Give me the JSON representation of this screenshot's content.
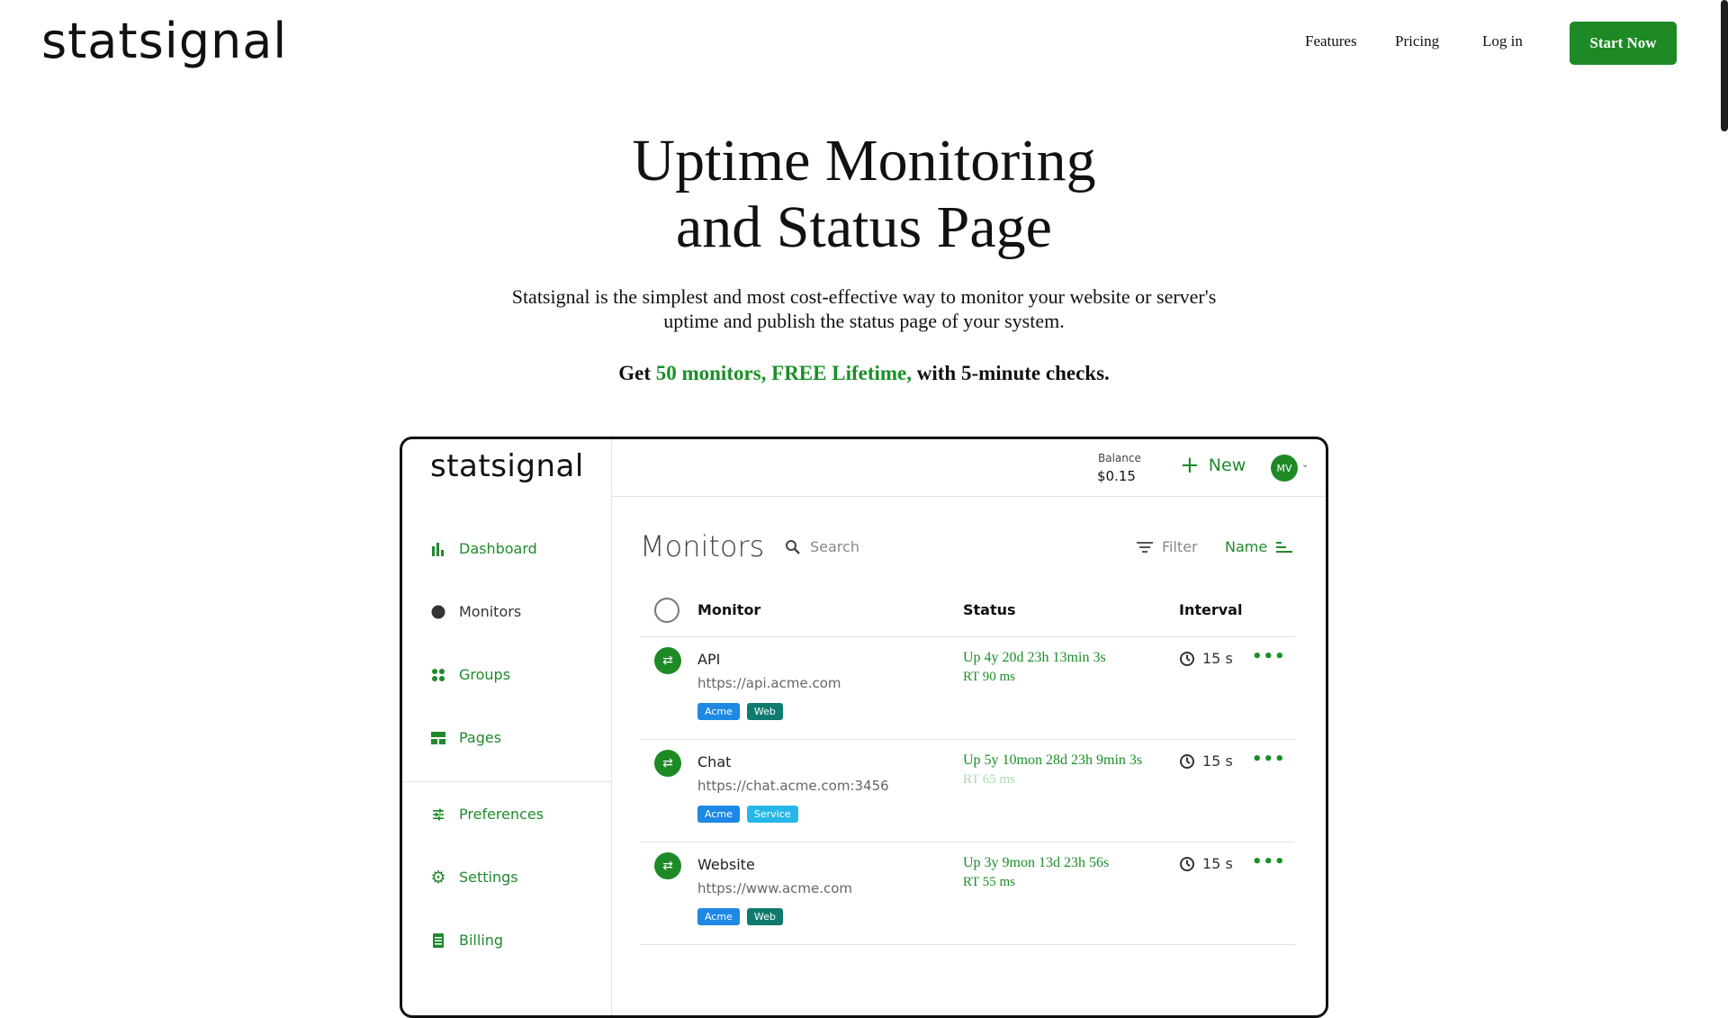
{
  "nav": {
    "logo": "statsignal",
    "links": [
      "Features",
      "Pricing",
      "Log in"
    ],
    "cta": "Start Now"
  },
  "hero": {
    "title_line1": "Uptime Monitoring",
    "title_line2": "and Status Page",
    "subtitle": "Statsignal is the simplest and most cost-effective way to monitor your website or server's uptime and publish the status page of your system.",
    "offer_prefix": "Get ",
    "offer_highlight": "50 monitors, FREE Lifetime,",
    "offer_suffix": " with 5-minute checks."
  },
  "app": {
    "logo": "statsignal",
    "sidebar": [
      {
        "label": "Dashboard",
        "icon": "bar-chart-icon"
      },
      {
        "label": "Monitors",
        "icon": "circle-icon"
      },
      {
        "label": "Groups",
        "icon": "dots-grid-icon"
      },
      {
        "label": "Pages",
        "icon": "layout-icon"
      },
      {
        "label": "Preferences",
        "icon": "sliders-icon"
      },
      {
        "label": "Settings",
        "icon": "gear-icon"
      },
      {
        "label": "Billing",
        "icon": "receipt-icon"
      }
    ],
    "balance_label": "Balance",
    "balance_value": "$0.15",
    "new_label": "New",
    "avatar": "MV",
    "page_title": "Monitors",
    "search_placeholder": "Search",
    "filter_label": "Filter",
    "sort_label": "Name",
    "columns": [
      "Monitor",
      "Status",
      "Interval"
    ],
    "rows": [
      {
        "name": "API",
        "url": "https://api.acme.com",
        "tags": [
          "Acme",
          "Web"
        ],
        "status": "Up 4y 20d 23h 13min 3s",
        "rt": "RT 90 ms",
        "interval": "15 s"
      },
      {
        "name": "Chat",
        "url": "https://chat.acme.com:3456",
        "tags": [
          "Acme",
          "Service"
        ],
        "status": "Up 5y 10mon 28d 23h 9min 3s",
        "rt": "RT 65 ms",
        "interval": "15 s"
      },
      {
        "name": "Website",
        "url": "https://www.acme.com",
        "tags": [
          "Acme",
          "Web"
        ],
        "status": "Up 3y 9mon 13d 23h 56s",
        "rt": "RT 55 ms",
        "interval": "15 s"
      }
    ]
  },
  "colors": {
    "brand_green": "#1d8a25",
    "tag_blue": "#1e88e5",
    "tag_teal": "#0f7a6e",
    "tag_cyan": "#26b7ea"
  }
}
